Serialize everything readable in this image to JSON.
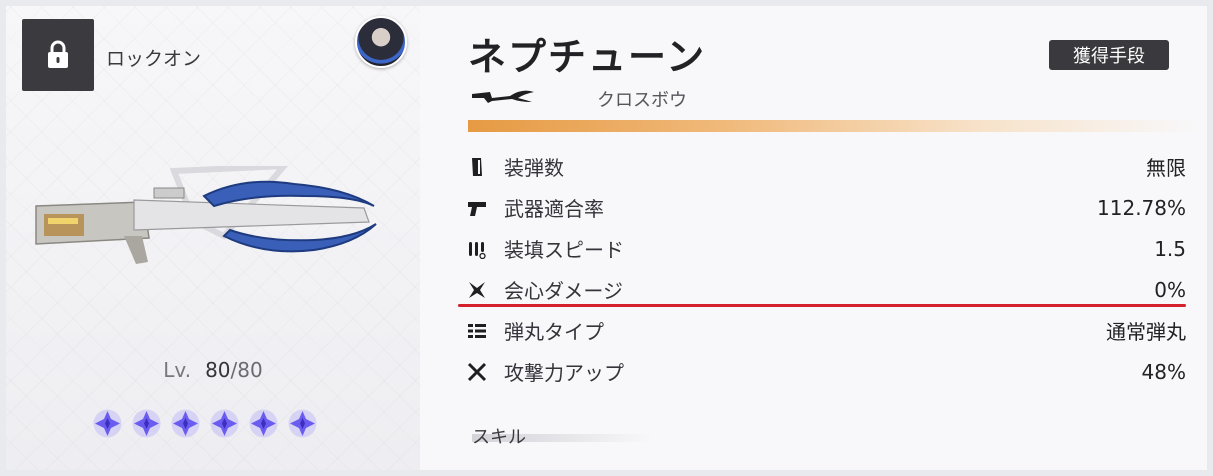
{
  "lock": {
    "label": "ロックオン",
    "icon": "padlock-icon"
  },
  "avatar": {
    "icon": "character-avatar"
  },
  "weapon": {
    "name": "ネプチューン",
    "type_label": "クロスボウ",
    "type_icon": "crossbow-silhouette-icon",
    "acquisition_button": "獲得手段"
  },
  "level": {
    "label": "Lv.",
    "current": "80",
    "separator": "/",
    "max": "80"
  },
  "stars": {
    "count": 6,
    "icon": "star-gem-icon",
    "color": "#6b5cf0"
  },
  "stats": [
    {
      "icon": "magazine-icon",
      "label": "装弾数",
      "value": "無限"
    },
    {
      "icon": "pistol-icon",
      "label": "武器適合率",
      "value": "112.78%"
    },
    {
      "icon": "bullets-icon",
      "label": "装填スピード",
      "value": "1.5"
    },
    {
      "icon": "crit-burst-icon",
      "label": "会心ダメージ",
      "value": "0%"
    },
    {
      "icon": "bullet-list-icon",
      "label": "弾丸タイプ",
      "value": "通常弾丸"
    },
    {
      "icon": "crossed-swords-icon",
      "label": "攻撃力アップ",
      "value": "48%"
    }
  ],
  "skill": {
    "label": "スキル"
  },
  "colors": {
    "accent": "#e69a43",
    "highlight": "#d5202e",
    "dark": "#3a3a3e"
  }
}
